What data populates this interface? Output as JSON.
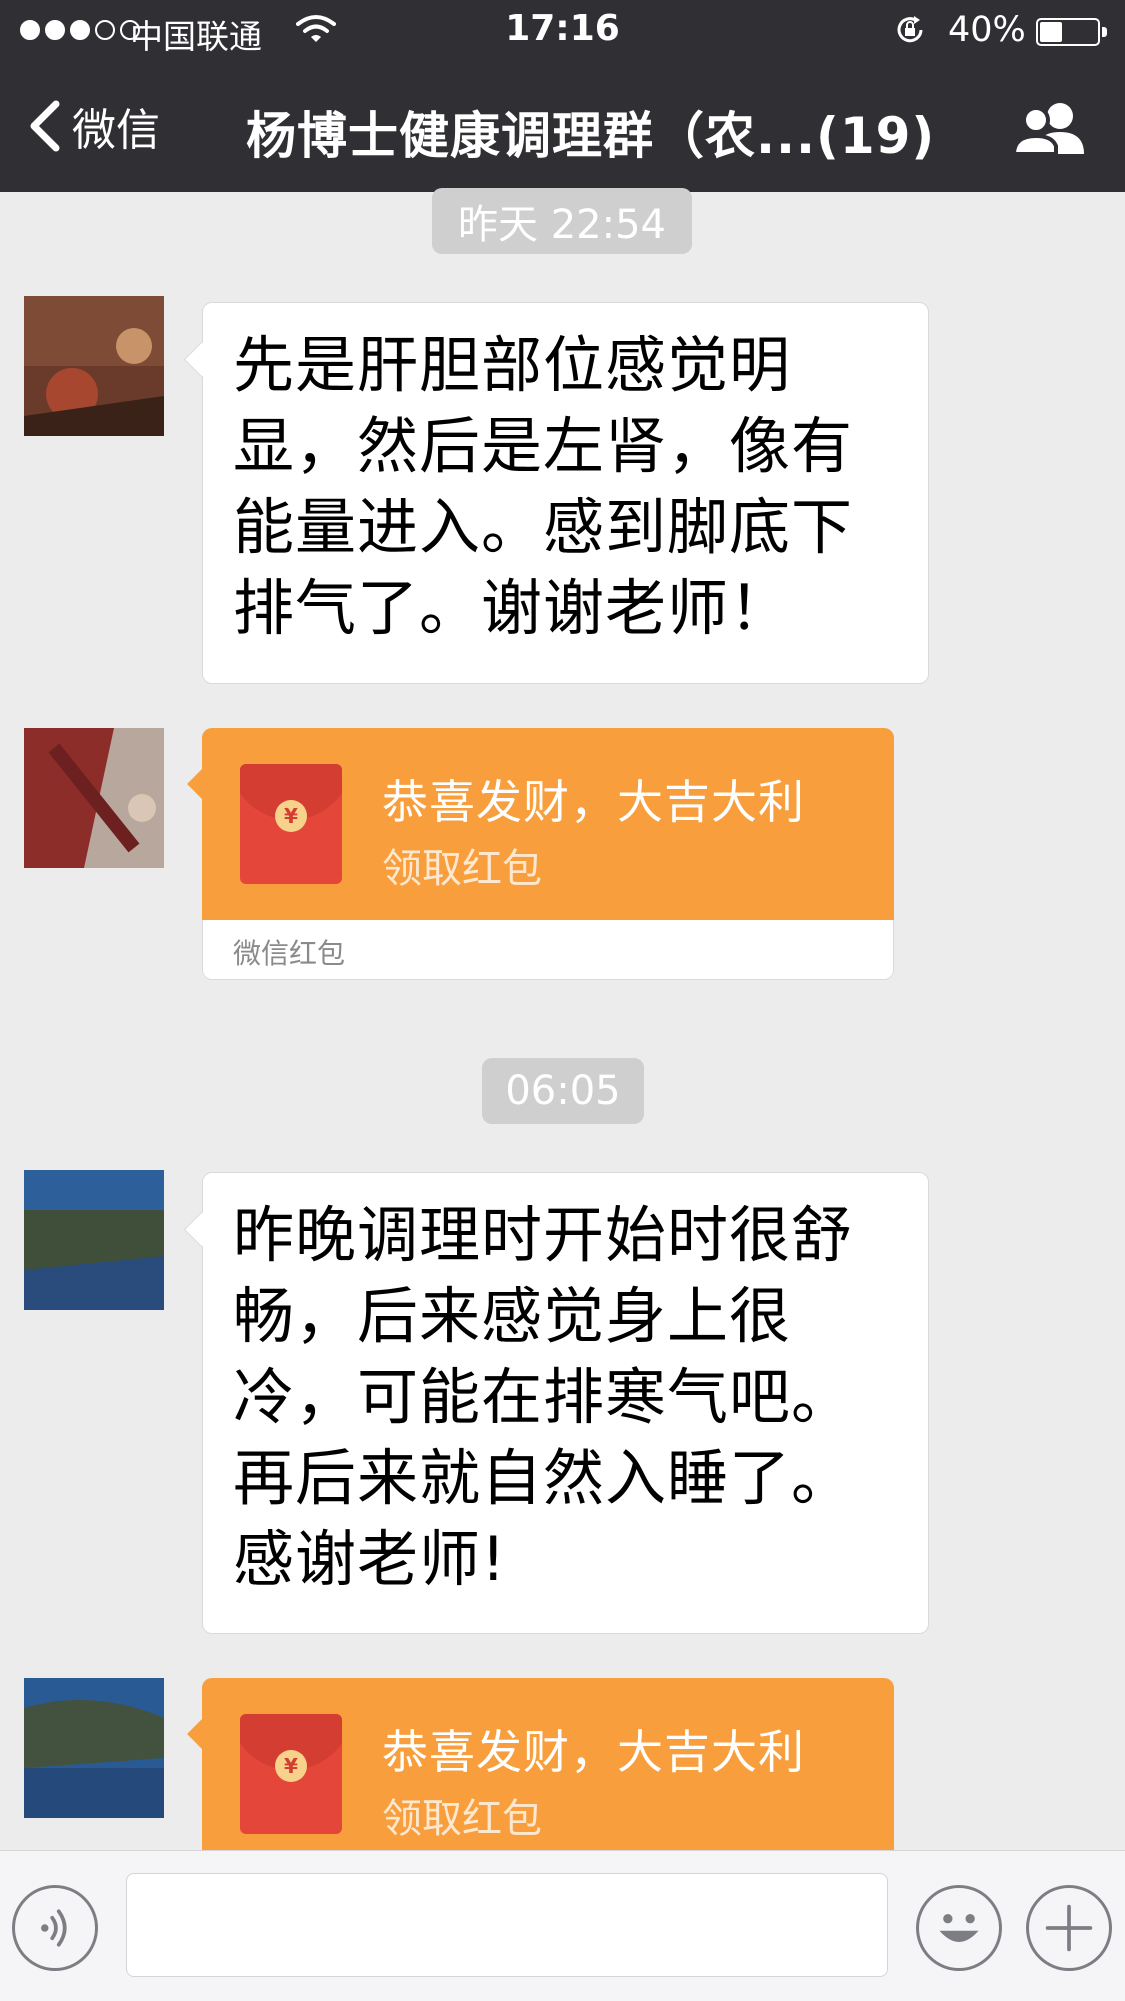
{
  "status_bar": {
    "signal": [
      1,
      1,
      1,
      0,
      0
    ],
    "carrier": "中国联通",
    "time": "17:16",
    "battery_percent_label": "40%",
    "battery_level": 0.4,
    "icons": [
      "wifi-icon",
      "rotation-lock-icon",
      "battery-icon"
    ]
  },
  "nav": {
    "back_label": "微信",
    "title": "杨博士健康调理群（农...(19)",
    "icons": [
      "back-chevron-icon",
      "group-members-icon"
    ]
  },
  "chat": {
    "timestamps": [
      "昨天 22:54",
      "06:05"
    ],
    "messages": [
      {
        "type": "text",
        "text": "先是肝胆部位感觉明\n显，然后是左肾，像有\n能量进入。感到脚底下\n排气了。谢谢老师！"
      },
      {
        "type": "red_packet",
        "title": "恭喜发财，大吉大利",
        "action": "领取红包",
        "footer": "微信红包"
      },
      {
        "type": "text",
        "text": "昨晚调理时开始时很舒\n畅，后来感觉身上很\n冷，可能在排寒气吧。\n再后来就自然入睡了。\n感谢老师!"
      },
      {
        "type": "red_packet",
        "title": "恭喜发财，大吉大利",
        "action": "领取红包",
        "footer": ""
      }
    ]
  },
  "input_bar": {
    "icons": [
      "voice-icon",
      "emoji-icon",
      "plus-icon"
    ],
    "value": ""
  },
  "colors": {
    "nav_background": "#302f34",
    "chat_background": "#ececec",
    "red_packet_orange": "#f89e3c",
    "red_packet_envelope": "#e4473a"
  }
}
